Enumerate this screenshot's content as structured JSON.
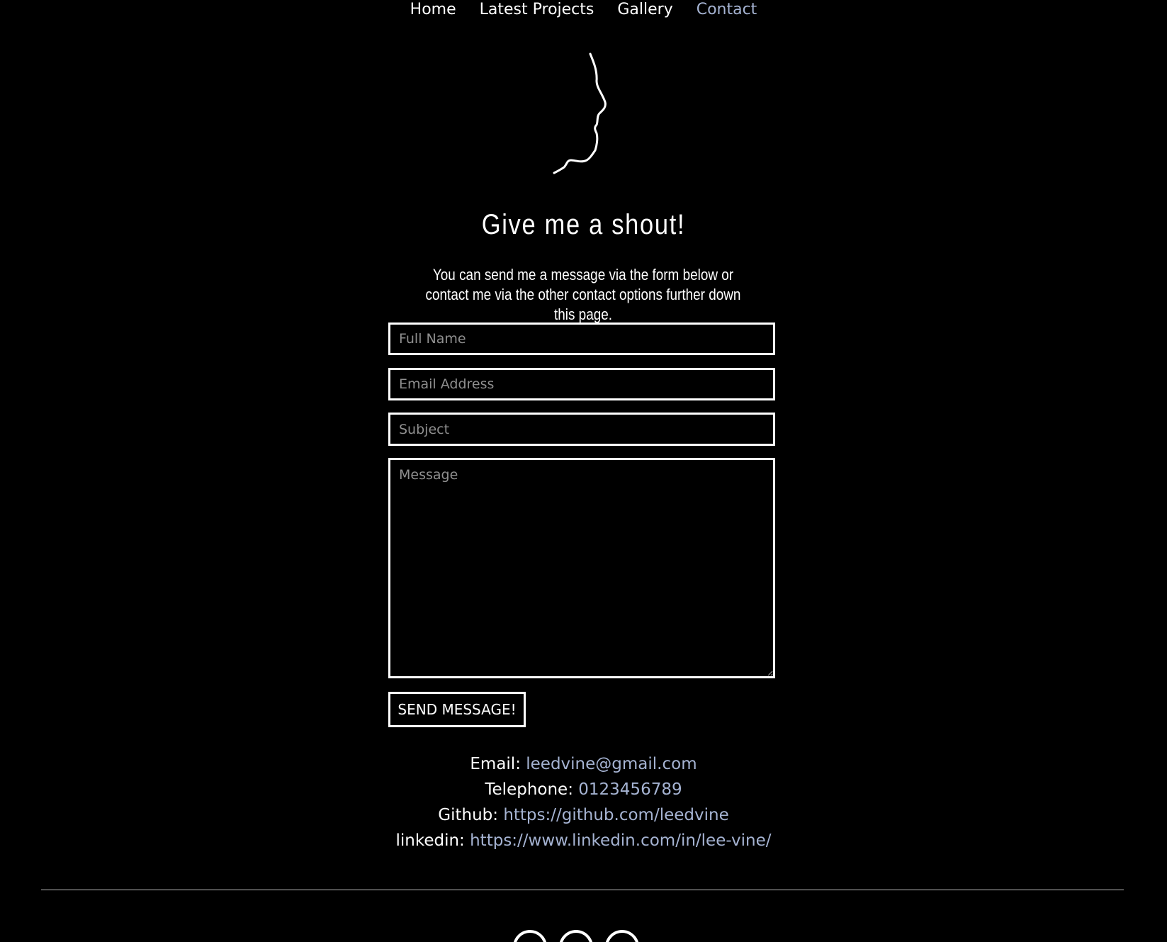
{
  "nav": {
    "items": [
      {
        "label": "Home",
        "active": false
      },
      {
        "label": "Latest Projects",
        "active": false
      },
      {
        "label": "Gallery",
        "active": false
      },
      {
        "label": "Contact",
        "active": true
      }
    ]
  },
  "heading": "Give me a shout!",
  "intro": "You can send me a message via the form below or contact me via the other contact options further down this page.",
  "form": {
    "name_placeholder": "Full Name",
    "email_placeholder": "Email Address",
    "subject_placeholder": "Subject",
    "message_placeholder": "Message",
    "submit_label": "SEND MESSAGE!"
  },
  "contacts": [
    {
      "label": "Email:",
      "value": "leedvine@gmail.com"
    },
    {
      "label": "Telephone:",
      "value": "0123456789"
    },
    {
      "label": "Github:",
      "value": "https://github.com/leedvine"
    },
    {
      "label": "linkedin:",
      "value": "https://www.linkedin.com/in/lee-vine/"
    }
  ],
  "footer": {
    "socials": [
      {
        "icon": "linkedin-icon"
      },
      {
        "icon": "github-icon"
      },
      {
        "icon": "email-icon"
      }
    ]
  },
  "colors": {
    "background": "#000000",
    "text": "#ffffff",
    "accent": "#a5b3d2"
  }
}
